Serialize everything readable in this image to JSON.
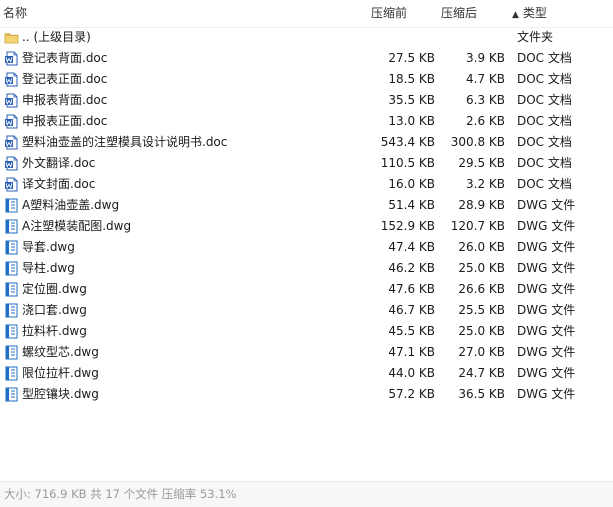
{
  "header": {
    "name_label": "名称",
    "orig_label": "压缩前",
    "comp_label": "压缩后",
    "sort_arrow": "▲",
    "type_label": "类型"
  },
  "rows": [
    {
      "icon": "folder",
      "name": ".. (上级目录)",
      "orig": "",
      "comp": "",
      "type": "文件夹"
    },
    {
      "icon": "doc",
      "name": "登记表背面.doc",
      "orig": "27.5 KB",
      "comp": "3.9 KB",
      "type": "DOC 文档"
    },
    {
      "icon": "doc",
      "name": "登记表正面.doc",
      "orig": "18.5 KB",
      "comp": "4.7 KB",
      "type": "DOC 文档"
    },
    {
      "icon": "doc",
      "name": "申报表背面.doc",
      "orig": "35.5 KB",
      "comp": "6.3 KB",
      "type": "DOC 文档"
    },
    {
      "icon": "doc",
      "name": "申报表正面.doc",
      "orig": "13.0 KB",
      "comp": "2.6 KB",
      "type": "DOC 文档"
    },
    {
      "icon": "doc",
      "name": "塑料油壶盖的注塑模具设计说明书.doc",
      "orig": "543.4 KB",
      "comp": "300.8 KB",
      "type": "DOC 文档"
    },
    {
      "icon": "doc",
      "name": "外文翻译.doc",
      "orig": "110.5 KB",
      "comp": "29.5 KB",
      "type": "DOC 文档"
    },
    {
      "icon": "doc",
      "name": "译文封面.doc",
      "orig": "16.0 KB",
      "comp": "3.2 KB",
      "type": "DOC 文档"
    },
    {
      "icon": "dwg",
      "name": "A塑料油壶盖.dwg",
      "orig": "51.4 KB",
      "comp": "28.9 KB",
      "type": "DWG 文件"
    },
    {
      "icon": "dwg",
      "name": "A注塑模装配图.dwg",
      "orig": "152.9 KB",
      "comp": "120.7 KB",
      "type": "DWG 文件"
    },
    {
      "icon": "dwg",
      "name": "导套.dwg",
      "orig": "47.4 KB",
      "comp": "26.0 KB",
      "type": "DWG 文件"
    },
    {
      "icon": "dwg",
      "name": "导柱.dwg",
      "orig": "46.2 KB",
      "comp": "25.0 KB",
      "type": "DWG 文件"
    },
    {
      "icon": "dwg",
      "name": "定位圈.dwg",
      "orig": "47.6 KB",
      "comp": "26.6 KB",
      "type": "DWG 文件"
    },
    {
      "icon": "dwg",
      "name": "浇口套.dwg",
      "orig": "46.7 KB",
      "comp": "25.5 KB",
      "type": "DWG 文件"
    },
    {
      "icon": "dwg",
      "name": "拉料杆.dwg",
      "orig": "45.5 KB",
      "comp": "25.0 KB",
      "type": "DWG 文件"
    },
    {
      "icon": "dwg",
      "name": "螺纹型芯.dwg",
      "orig": "47.1 KB",
      "comp": "27.0 KB",
      "type": "DWG 文件"
    },
    {
      "icon": "dwg",
      "name": "限位拉杆.dwg",
      "orig": "44.0 KB",
      "comp": "24.7 KB",
      "type": "DWG 文件"
    },
    {
      "icon": "dwg",
      "name": "型腔镶块.dwg",
      "orig": "57.2 KB",
      "comp": "36.5 KB",
      "type": "DWG 文件"
    }
  ],
  "status": {
    "text": "大小: 716.9 KB 共 17 个文件 压缩率 53.1%"
  },
  "colors": {
    "folder": "#e9c25c",
    "doc_blue": "#2b5fb4",
    "dwg_blue": "#1f6fc5"
  }
}
